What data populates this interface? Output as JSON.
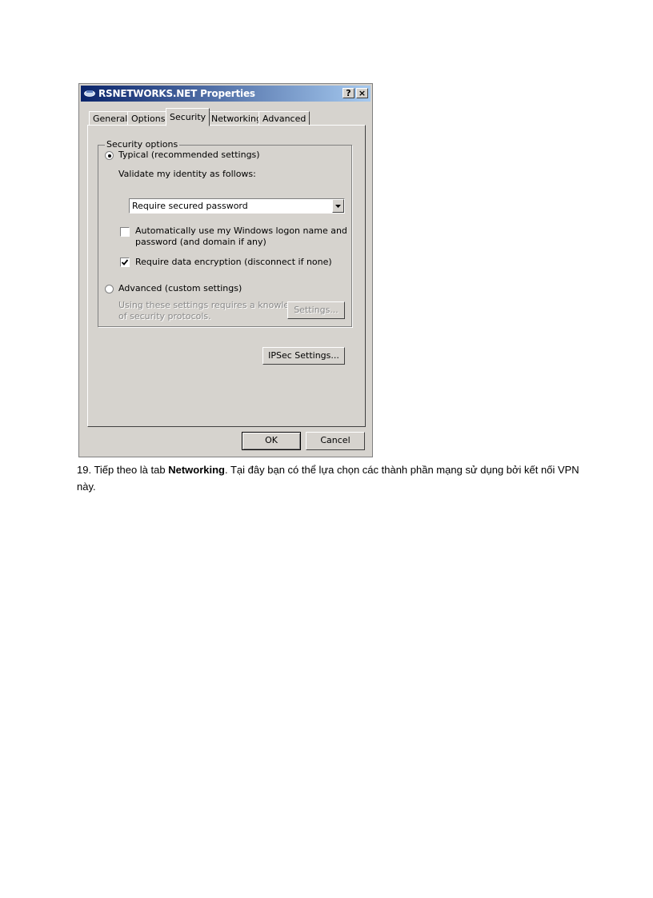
{
  "dialog": {
    "title": "RSNETWORKS.NET Properties",
    "help_label": "?",
    "close_label": "×",
    "tabs": [
      {
        "label": "General"
      },
      {
        "label": "Options"
      },
      {
        "label": "Security",
        "active": true
      },
      {
        "label": "Networking"
      },
      {
        "label": "Advanced"
      }
    ],
    "security": {
      "group_label": "Security options",
      "typical_label": "Typical (recommended settings)",
      "typical_selected": true,
      "validate_label": "Validate my identity as follows:",
      "validate_value": "Require secured password",
      "auto_logon_line1": "Automatically use my Windows logon name and",
      "auto_logon_line2": "password (and domain if any)",
      "auto_logon_checked": false,
      "encryption_label": "Require data encryption (disconnect if none)",
      "encryption_checked": true,
      "advanced_label": "Advanced (custom settings)",
      "advanced_selected": false,
      "advanced_desc_line1": "Using these settings requires a knowledge",
      "advanced_desc_line2": "of security protocols.",
      "settings_button": "Settings...",
      "ipsec_button": "IPSec Settings..."
    },
    "ok_button": "OK",
    "cancel_button": "Cancel"
  },
  "caption": {
    "prefix": "19. Tiếp theo là tab ",
    "bold": "Networking",
    "suffix": ". Tại đây bạn có thể lựa chọn các thành phần mạng sử dụng bởi kết nối VPN này."
  }
}
